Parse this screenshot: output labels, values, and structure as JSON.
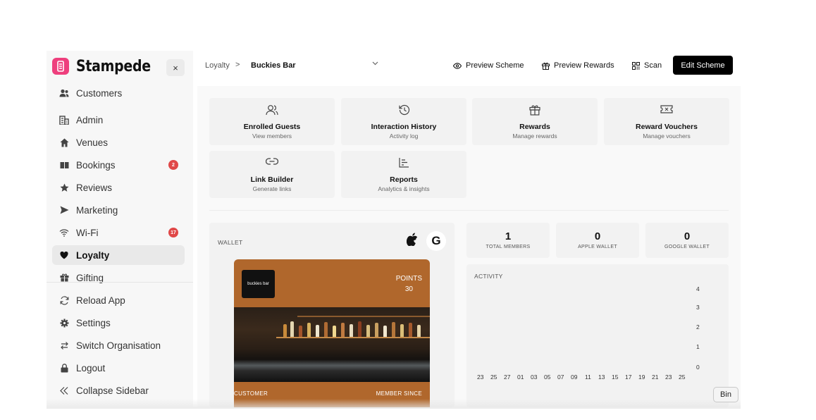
{
  "brand": {
    "name": "Stampede",
    "accent": "#ee3f7d"
  },
  "sidebar": {
    "close_glyph": "×",
    "items": [
      {
        "label": "Customers",
        "icon": "users-icon"
      },
      {
        "label": "Admin",
        "icon": "building-icon"
      },
      {
        "label": "Venues",
        "icon": "home-icon"
      },
      {
        "label": "Bookings",
        "icon": "book-icon",
        "badge": "2"
      },
      {
        "label": "Reviews",
        "icon": "star-icon"
      },
      {
        "label": "Marketing",
        "icon": "send-icon"
      },
      {
        "label": "Wi-Fi",
        "icon": "wifi-icon",
        "badge": "17"
      },
      {
        "label": "Loyalty",
        "icon": "heart-icon",
        "active": true
      },
      {
        "label": "Gifting",
        "icon": "gift-icon"
      }
    ],
    "footer_items": [
      {
        "label": "Reload App",
        "icon": "refresh-icon"
      },
      {
        "label": "Settings",
        "icon": "gear-icon"
      },
      {
        "label": "Switch Organisation",
        "icon": "switch-icon"
      },
      {
        "label": "Logout",
        "icon": "lock-icon"
      },
      {
        "label": "Collapse Sidebar",
        "icon": "chevrons-left-icon"
      }
    ]
  },
  "topbar": {
    "breadcrumb_root": "Loyalty",
    "breadcrumb_sep": ">",
    "venue": "Buckies Bar",
    "preview_scheme": "Preview Scheme",
    "preview_rewards": "Preview Rewards",
    "scan": "Scan",
    "edit_scheme": "Edit Scheme"
  },
  "tiles": [
    {
      "title": "Enrolled Guests",
      "subtitle": "View members",
      "icon": "users-icon"
    },
    {
      "title": "Interaction History",
      "subtitle": "Activity log",
      "icon": "history-icon"
    },
    {
      "title": "Rewards",
      "subtitle": "Manage rewards",
      "icon": "gift-icon"
    },
    {
      "title": "Reward Vouchers",
      "subtitle": "Manage vouchers",
      "icon": "ticket-icon"
    },
    {
      "title": "Link Builder",
      "subtitle": "Generate links",
      "icon": "link-icon"
    },
    {
      "title": "Reports",
      "subtitle": "Analytics & insights",
      "icon": "bar-chart-icon"
    }
  ],
  "wallet": {
    "title": "WALLET",
    "google_glyph": "G",
    "pass": {
      "logo_text": "buckies bar",
      "points_label": "POINTS",
      "points_value": "30",
      "footer_left": "CUSTOMER",
      "footer_right": "MEMBER SINCE",
      "color": "#b0672c"
    }
  },
  "stats": [
    {
      "value": "1",
      "label": "TOTAL MEMBERS"
    },
    {
      "value": "0",
      "label": "APPLE WALLET"
    },
    {
      "value": "0",
      "label": "GOOGLE WALLET"
    }
  ],
  "activity": {
    "title": "ACTIVITY",
    "y_ticks": [
      "4",
      "3",
      "2",
      "1",
      "0"
    ],
    "x_ticks": [
      "23",
      "25",
      "27",
      "01",
      "03",
      "05",
      "07",
      "09",
      "11",
      "13",
      "15",
      "17",
      "19",
      "21",
      "23",
      "25"
    ]
  },
  "tooltip": "Bin"
}
